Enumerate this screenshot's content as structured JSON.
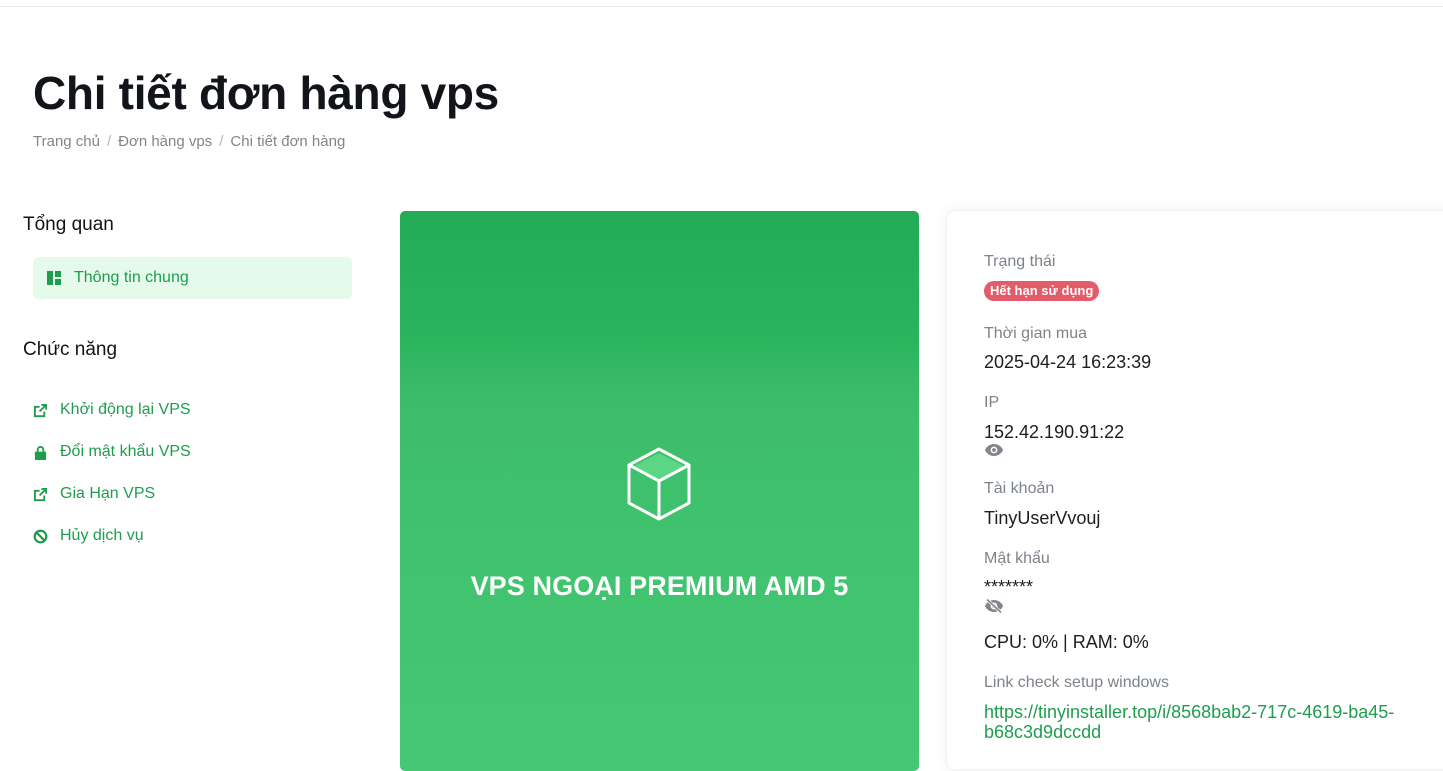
{
  "page": {
    "title": "Chi tiết đơn hàng vps",
    "breadcrumb": [
      "Trang chủ",
      "Đơn hàng vps",
      "Chi tiết đơn hàng"
    ]
  },
  "sidebar": {
    "overview_title": "Tổng quan",
    "overview_item": "Thông tin chung",
    "functions_title": "Chức năng",
    "functions": [
      {
        "label": "Khởi động lại VPS",
        "icon": "external-link-icon"
      },
      {
        "label": "Đổi mật khẩu VPS",
        "icon": "lock-icon"
      },
      {
        "label": "Gia Hạn VPS",
        "icon": "external-link-icon"
      },
      {
        "label": "Hủy dịch vụ",
        "icon": "ban-icon"
      }
    ]
  },
  "product": {
    "name": "VPS NGOẠI PREMIUM AMD 5",
    "icon": "cube-icon"
  },
  "info": {
    "status_label": "Trạng thái",
    "status_value": "Hết hạn sử dụng",
    "purchase_label": "Thời gian mua",
    "purchase_value": "2025-04-24 16:23:39",
    "ip_label": "IP",
    "ip_value": "152.42.190.91:22",
    "account_label": "Tài khoản",
    "account_value": "TinyUserVvouj",
    "password_label": "Mật khẩu",
    "password_value": "*******",
    "usage": "CPU: 0% | RAM: 0%",
    "link_label": "Link check setup windows",
    "link_value": "https://tinyinstaller.top/i/8568bab2-717c-4619-ba45-b68c3d9dccdd"
  },
  "colors": {
    "accent": "#1e9e4d",
    "card_green": "#2ab35c",
    "badge_red": "#e25c69"
  }
}
